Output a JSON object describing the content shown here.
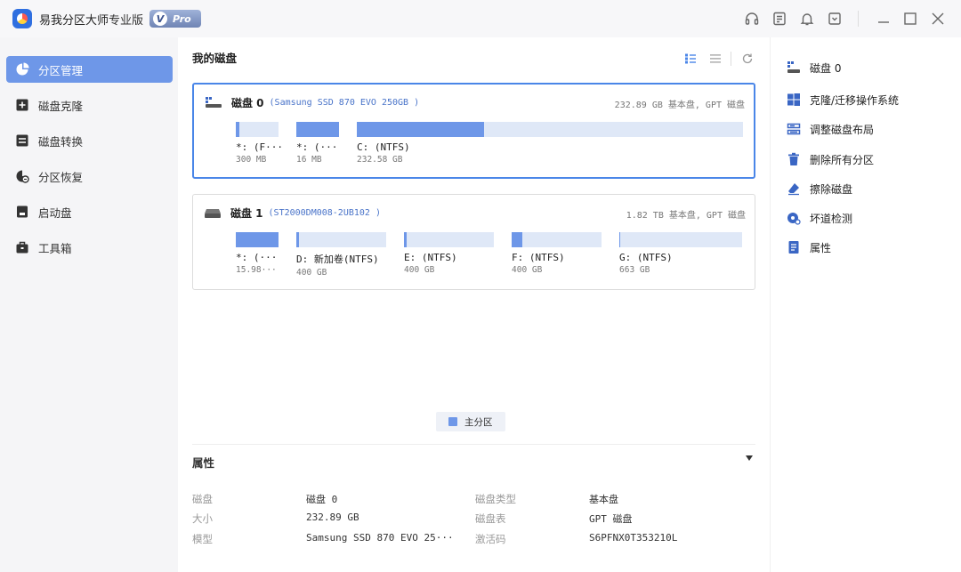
{
  "app": {
    "title": "易我分区大师",
    "edition": "专业版",
    "badge_v": "V",
    "badge_text": "Pro"
  },
  "sidebar": {
    "items": [
      {
        "label": "分区管理",
        "icon": "pie-chart-icon",
        "active": true
      },
      {
        "label": "磁盘克隆",
        "icon": "disk-clone-icon",
        "active": false
      },
      {
        "label": "磁盘转换",
        "icon": "disk-convert-icon",
        "active": false
      },
      {
        "label": "分区恢复",
        "icon": "partition-recovery-icon",
        "active": false
      },
      {
        "label": "启动盘",
        "icon": "boot-disk-icon",
        "active": false
      },
      {
        "label": "工具箱",
        "icon": "toolbox-icon",
        "active": false
      }
    ]
  },
  "main": {
    "title": "我的磁盘",
    "disks": [
      {
        "name": "磁盘 0",
        "model": "(Samsung SSD 870 EVO 250GB )",
        "summary": "232.89 GB 基本盘, GPT 磁盘",
        "partitions": [
          {
            "label": "*: (F···",
            "size": "300 MB",
            "used": 0.08
          },
          {
            "label": "*: (···",
            "size": "16 MB",
            "used": 1.0
          },
          {
            "label": "C: (NTFS)",
            "size": "232.58 GB",
            "used": 0.33
          }
        ]
      },
      {
        "name": "磁盘 1",
        "model": "(ST2000DM008-2UB102 )",
        "summary": "1.82 TB 基本盘, GPT 磁盘",
        "partitions": [
          {
            "label": "*: (···",
            "size": "15.98···",
            "used": 1.0
          },
          {
            "label": "D: 新加卷(NTFS)",
            "size": "400 GB",
            "used": 0.03
          },
          {
            "label": "E: (NTFS)",
            "size": "400 GB",
            "used": 0.03
          },
          {
            "label": "F: (NTFS)",
            "size": "400 GB",
            "used": 0.12
          },
          {
            "label": "G: (NTFS)",
            "size": "663 GB",
            "used": 0.01
          }
        ]
      }
    ],
    "legend": "主分区"
  },
  "properties": {
    "title": "属性",
    "rows": [
      {
        "k1": "磁盘",
        "v1": "磁盘 0",
        "k2": "磁盘类型",
        "v2": "基本盘"
      },
      {
        "k1": "大小",
        "v1": "232.89 GB",
        "k2": "磁盘表",
        "v2": "GPT 磁盘"
      },
      {
        "k1": "模型",
        "v1": "Samsung SSD 870 EVO 25···",
        "k2": "激活码",
        "v2": "S6PFNX0T353210L"
      }
    ]
  },
  "right_panel": {
    "items": [
      {
        "label": "磁盘 0",
        "icon": "disk-icon"
      },
      {
        "label": "克隆/迁移操作系统",
        "icon": "windows-icon"
      },
      {
        "label": "调整磁盘布局",
        "icon": "adjust-layout-icon"
      },
      {
        "label": "删除所有分区",
        "icon": "trash-icon"
      },
      {
        "label": "擦除磁盘",
        "icon": "eraser-icon"
      },
      {
        "label": "坏道检测",
        "icon": "bad-sector-icon"
      },
      {
        "label": "属性",
        "icon": "properties-icon"
      }
    ]
  },
  "colors": {
    "accent": "#6e97e8",
    "bar_empty": "#dfe8f7",
    "selected_border": "#4a86e8",
    "sidebar_bg": "#f5f5f7"
  }
}
